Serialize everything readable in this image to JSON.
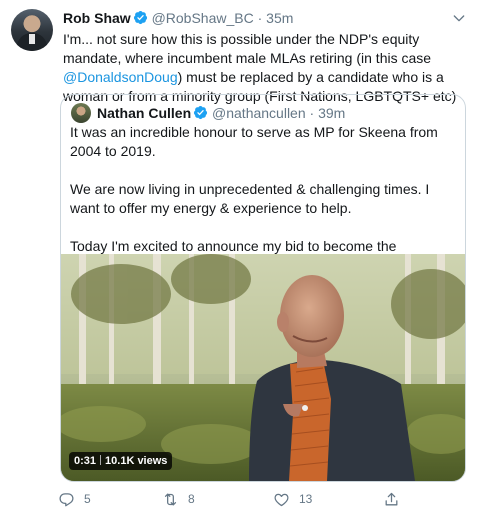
{
  "tweet": {
    "author_name": "Rob Shaw",
    "author_handle": "@RobShaw_BC",
    "separator": "·",
    "time": "35m",
    "text_before": "I'm... not sure how this is possible under the NDP's equity mandate, where incumbent male MLAs retiring (in this case ",
    "mention": "@DonaldsonDoug",
    "text_after": ") must be replaced by a candidate who is a woman or from a minority group (First Nations, LGBTQTS+ etc)"
  },
  "quoted": {
    "author_name": "Nathan Cullen",
    "author_handle": "@nathancullen",
    "separator": "·",
    "time": "39m",
    "paragraphs": [
      "It was an incredible honour to serve as MP for Skeena from 2004 to 2019.",
      "We are now living in unprecedented & challenging times. I want to offer my energy & experience to help.",
      "Today I'm excited to announce my bid to become the candidate for the BC NDP riding of Stikine #bcpoli"
    ],
    "video": {
      "duration": "0:31",
      "views": "10.1K views"
    }
  },
  "actions": {
    "replies": "5",
    "retweets": "8",
    "likes": "13"
  },
  "colors": {
    "link": "#1b95e0",
    "secondary": "#657786",
    "verified": "#1da1f2",
    "border": "#ccd6dd"
  }
}
